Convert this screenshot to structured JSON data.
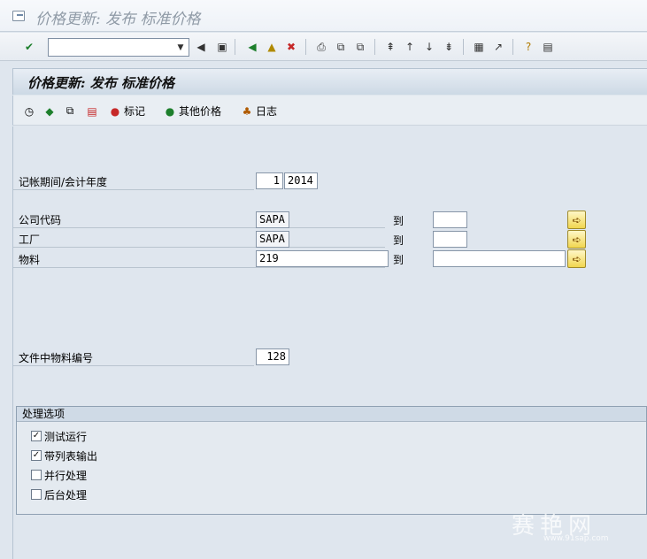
{
  "window": {
    "title": "价格更新: 发布 标准价格"
  },
  "toolbar": {
    "command_field": {
      "value": ""
    }
  },
  "header": {
    "title": "价格更新: 发布 标准价格"
  },
  "app_toolbar": {
    "mark_label": "标记",
    "other_prices_label": "其他价格",
    "log_label": "日志"
  },
  "form": {
    "posting_period": {
      "label": "记帐期间/会计年度",
      "period": "1",
      "year": "2014"
    },
    "company_code": {
      "label": "公司代码",
      "from": "SAPA",
      "to_label": "到",
      "to": ""
    },
    "plant": {
      "label": "工厂",
      "from": "SAPA",
      "to_label": "到",
      "to": ""
    },
    "material": {
      "label": "物料",
      "from": "219",
      "to_label": "到",
      "to": ""
    },
    "file_material_count": {
      "label": "文件中物料编号",
      "value": "128"
    }
  },
  "processing_options": {
    "title": "处理选项",
    "items": [
      {
        "label": "测试运行",
        "checked": true
      },
      {
        "label": "带列表输出",
        "checked": true
      },
      {
        "label": "并行处理",
        "checked": false
      },
      {
        "label": "后台处理",
        "checked": false
      }
    ]
  },
  "watermark": {
    "text": "赛艳网",
    "sub": "www.91sap.com"
  },
  "colors": {
    "background": "#dfe6ee",
    "header": "#cdd9e5",
    "accent_button": "#f1d64f",
    "ok_green": "#1d7f2c"
  }
}
